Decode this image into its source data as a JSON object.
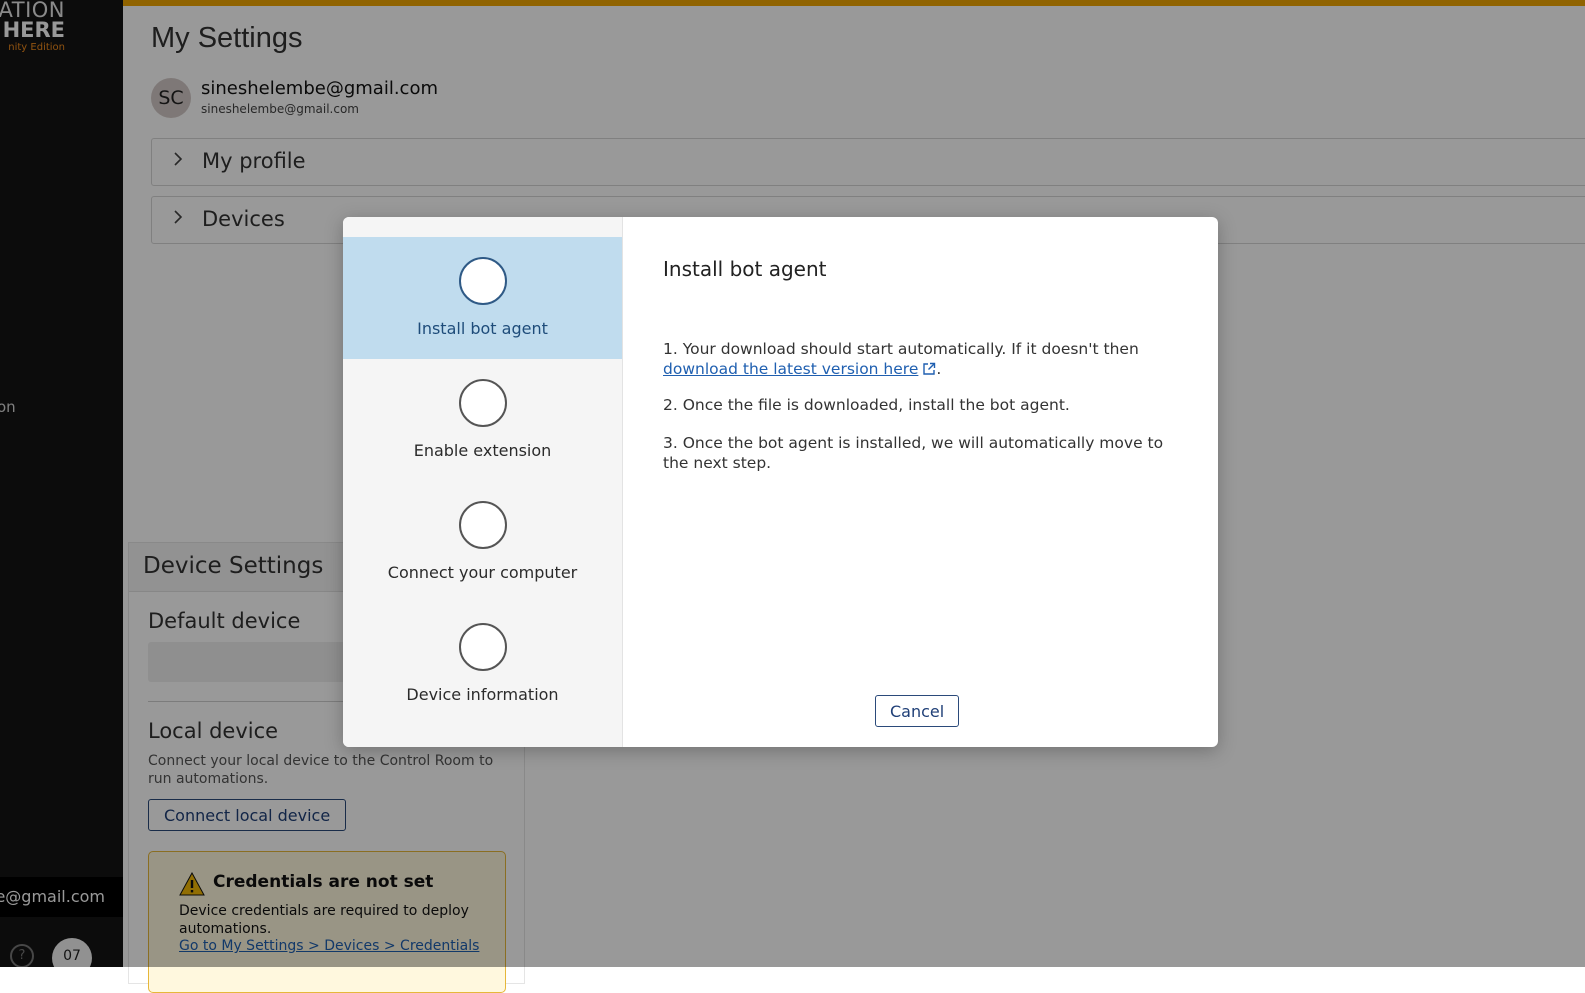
{
  "sidebar": {
    "brand_line1": "ATION",
    "brand_line2": "HERE",
    "brand_line3": "nity Edition",
    "fragment": "on",
    "user_email_fragment": "e@gmail.com",
    "help_icon": "question-icon",
    "avatar_fragment": "07"
  },
  "topbar_color": "#f0a500",
  "page": {
    "title": "My Settings",
    "user": {
      "initials": "SC",
      "name": "sineshelembe@gmail.com",
      "email": "sineshelembe@gmail.com"
    },
    "accordions": [
      {
        "label": "My profile",
        "icon": "chevron-right-icon"
      },
      {
        "label": "Devices",
        "icon": "chevron-right-icon"
      }
    ]
  },
  "device_settings": {
    "title": "Device Settings",
    "default_device_label": "Default device",
    "local_device_label": "Local device",
    "local_device_desc": "Connect your local device to the Control Room to run automations.",
    "connect_button": "Connect local device",
    "warning": {
      "title": "Credentials are not set",
      "body": "Device credentials are required to deploy automations.",
      "link": "Go to My Settings > Devices > Credentials"
    }
  },
  "modal": {
    "steps": [
      {
        "label": "Install bot agent",
        "active": true
      },
      {
        "label": "Enable extension",
        "active": false
      },
      {
        "label": "Connect your computer",
        "active": false
      },
      {
        "label": "Device information",
        "active": false
      }
    ],
    "title": "Install bot agent",
    "instruction1_prefix": "1. Your download should start automatically. If it doesn't then",
    "instruction1_link": "download the latest version here",
    "instruction1_suffix": ".",
    "instruction2": "2. Once the file is downloaded, install the bot agent.",
    "instruction3": "3. Once the bot agent is installed, we will automatically move to the next step.",
    "cancel_button": "Cancel"
  }
}
